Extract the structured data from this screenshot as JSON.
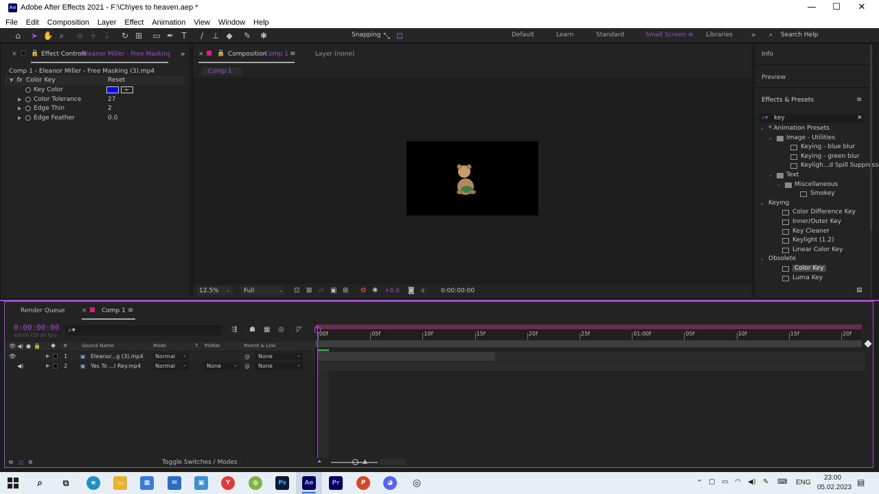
{
  "window": {
    "app_badge": "Ae",
    "title": "Adobe After Effects 2021 - F:\\Ch\\yes to heaven.aep *",
    "min": "—",
    "max": "☐",
    "close": "✕"
  },
  "menu": [
    "File",
    "Edit",
    "Composition",
    "Layer",
    "Effect",
    "Animation",
    "View",
    "Window",
    "Help"
  ],
  "toolbar": {
    "snapping_label": "Snapping",
    "workspaces": [
      "Default",
      "Learn",
      "Standard",
      "Small Screen",
      "Libraries"
    ],
    "active_workspace": "Small Screen",
    "more": "»",
    "search_help": "Search Help"
  },
  "effect_controls": {
    "tab_label": "Effect Controls",
    "tab_layer": "Eleanor Miller - Free Masking (",
    "layer_path": "Comp 1 - Eleanor Miller - Free Masking (3).mp4",
    "effect_name": "Color Key",
    "reset_label": "Reset",
    "fx_badge": "fx",
    "props": [
      {
        "name": "Key Color",
        "value": ""
      },
      {
        "name": "Color Tolerance",
        "value": "27"
      },
      {
        "name": "Edge Thin",
        "value": "2"
      },
      {
        "name": "Edge Feather",
        "value": "0.0"
      }
    ],
    "key_color_hex": "#0000ff"
  },
  "composition": {
    "tab_label": "Composition",
    "tab_comp": "Comp 1",
    "layer_tab": "Layer (none)",
    "comp_crumb": "Comp 1",
    "zoom": "12.5%",
    "resolution": "Full",
    "exposure": "+0.0",
    "timecode": "0:00:00:00"
  },
  "right_panel": {
    "info": "Info",
    "preview": "Preview",
    "effects_presets": "Effects & Presets",
    "search_value": "key",
    "tree": [
      {
        "label": "* Animation Presets",
        "level": 0,
        "kind": "group"
      },
      {
        "label": "Image - Utilities",
        "level": 1,
        "kind": "folder"
      },
      {
        "label": "Keying - blue blur",
        "level": 2,
        "kind": "item"
      },
      {
        "label": "Keying - green blur",
        "level": 2,
        "kind": "item"
      },
      {
        "label": "Keyligh...d Spill Suppressor",
        "level": 2,
        "kind": "item"
      },
      {
        "label": "Text",
        "level": 1,
        "kind": "folder"
      },
      {
        "label": "Miscellaneous",
        "level": 2,
        "kind": "folder"
      },
      {
        "label": "Smokey",
        "level": 3,
        "kind": "item"
      },
      {
        "label": "Keying",
        "level": 0,
        "kind": "group"
      },
      {
        "label": "Color Difference Key",
        "level": 1,
        "kind": "item"
      },
      {
        "label": "Inner/Outer Key",
        "level": 1,
        "kind": "item"
      },
      {
        "label": "Key Cleaner",
        "level": 1,
        "kind": "item"
      },
      {
        "label": "Keylight (1.2)",
        "level": 1,
        "kind": "item"
      },
      {
        "label": "Linear Color Key",
        "level": 1,
        "kind": "item"
      },
      {
        "label": "Obsolete",
        "level": 0,
        "kind": "group"
      },
      {
        "label": "Color Key",
        "level": 1,
        "kind": "item",
        "selected": true
      },
      {
        "label": "Luma Key",
        "level": 1,
        "kind": "item"
      }
    ]
  },
  "timeline": {
    "render_queue": "Render Queue",
    "comp_tab": "Comp 1",
    "timecode": "0:00:00:00",
    "timecode_sub": "00000 (25.00 fps)",
    "columns": {
      "num": "#",
      "source": "Source Name",
      "mode": "Mode",
      "t": "T",
      "trkmat": "TrkMat",
      "parent": "Parent & Link"
    },
    "layers": [
      {
        "num": "1",
        "name": "Eleanor...g (3).mp4",
        "mode": "Normal",
        "trkmat": "",
        "parent": "None"
      },
      {
        "num": "2",
        "name": "Yes To ...l Rey.mp4",
        "mode": "Normal",
        "trkmat": "None",
        "parent": "None"
      }
    ],
    "ruler": [
      "00f",
      "05f",
      "10f",
      "15f",
      "20f",
      "25f",
      "01:00f",
      "05f",
      "10f",
      "15f",
      "20f"
    ],
    "toggle_label": "Toggle Switches / Modes"
  },
  "taskbar": {
    "lang": "ENG",
    "time": "23:00",
    "date": "05.02.2023"
  }
}
